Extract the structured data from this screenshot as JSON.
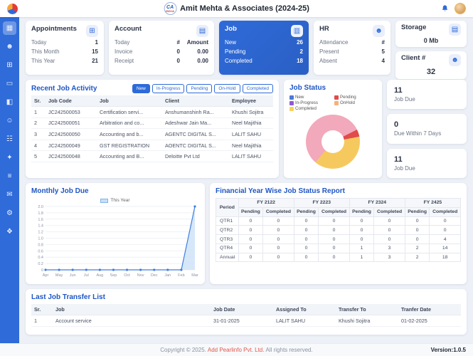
{
  "header": {
    "title": "Amit Mehta & Associates (2024-25)",
    "ca_logo": {
      "top": "CA",
      "bottom": "INDIA"
    }
  },
  "sidebar": {
    "items": [
      {
        "name": "dashboard",
        "glyph": "▦",
        "active": true
      },
      {
        "name": "clients",
        "glyph": "☻",
        "active": false
      },
      {
        "name": "appointments",
        "glyph": "⊞",
        "active": false
      },
      {
        "name": "workstation",
        "glyph": "▭",
        "active": false
      },
      {
        "name": "reports",
        "glyph": "◧",
        "active": false
      },
      {
        "name": "employees",
        "glyph": "☺",
        "active": false
      },
      {
        "name": "attendance",
        "glyph": "☷",
        "active": false
      },
      {
        "name": "jobs",
        "glyph": "✦",
        "active": false
      },
      {
        "name": "job-list",
        "glyph": "≡",
        "active": false
      },
      {
        "name": "documents",
        "glyph": "✉",
        "active": false
      },
      {
        "name": "settings",
        "glyph": "⚙",
        "active": false
      },
      {
        "name": "team",
        "glyph": "❖",
        "active": false
      }
    ]
  },
  "cards": {
    "appointments": {
      "title": "Appointments",
      "icon_glyph": "⊞",
      "rows": [
        [
          "Today",
          "1"
        ],
        [
          "This Month",
          "15"
        ],
        [
          "This Year",
          "21"
        ]
      ]
    },
    "account": {
      "title": "Account",
      "icon_glyph": "▤",
      "header_row": [
        "Today",
        "#",
        "Amount"
      ],
      "rows": [
        [
          "Invoice",
          "0",
          "0.00"
        ],
        [
          "Receipt",
          "0",
          "0.00"
        ]
      ]
    },
    "job": {
      "title": "Job",
      "icon_glyph": "▥",
      "rows": [
        [
          "New",
          "26"
        ],
        [
          "Pending",
          "2"
        ],
        [
          "Completed",
          "18"
        ]
      ]
    },
    "hr": {
      "title": "HR",
      "icon_glyph": "☻",
      "rows": [
        [
          "Attendance",
          "#"
        ],
        [
          "Present",
          "5"
        ],
        [
          "Absent",
          "4"
        ]
      ]
    },
    "storage": {
      "title": "Storage",
      "icon_glyph": "▤",
      "value": "0 Mb"
    },
    "client": {
      "title": "Client #",
      "icon_glyph": "☻",
      "value": "32"
    }
  },
  "recent": {
    "title": "Recent Job Activity",
    "filters": [
      "New",
      "In-Progress",
      "Pending",
      "On-Hold",
      "Completed"
    ],
    "active_filter": "New",
    "columns": [
      "Sr.",
      "Job Code",
      "Job",
      "Client",
      "Employee"
    ],
    "rows": [
      [
        "1",
        "JC242500053",
        "Certification servi...",
        "Anshumanshinh Ra...",
        "Khushi Sojitra"
      ],
      [
        "2",
        "JC242500051",
        "Arbitration and co...",
        "Adeshwar Jain Ma...",
        "Neel Majithia"
      ],
      [
        "3",
        "JC242500050",
        "Accounting and b...",
        "AGENTC DIGITAL S...",
        "LALIT SAHU"
      ],
      [
        "4",
        "JC242500049",
        "GST REGISTRATION",
        "AOENTC DIGITAL S...",
        "Neel Majithia"
      ],
      [
        "5",
        "JC242500048",
        "Accounting and B...",
        "Deloitte Pvt Ltd",
        "LALIT SAHU"
      ]
    ]
  },
  "side_stats": [
    {
      "value": "11",
      "label": "Job Due"
    },
    {
      "value": "0",
      "label": "Due Within 7 Days"
    },
    {
      "value": "11",
      "label": "Job Due"
    }
  ],
  "transfer": {
    "title": "Last Job Transfer List",
    "columns": [
      "Sr.",
      "Job",
      "Job Date",
      "Assigned To",
      "Transfer To",
      "Tranfer Date"
    ],
    "rows": [
      [
        "1",
        "Account service",
        "31-01-2025",
        "LALIT SAHU",
        "Khushi Sojitra",
        "01-02-2025"
      ]
    ]
  },
  "footer": {
    "prefix": "Copyright © 2025.",
    "link": "Add Pearlinfo Pvt. Ltd.",
    "suffix": " All rights reserved.",
    "version": "Version:1.0.5"
  },
  "chart_data": [
    {
      "id": "job_status_donut",
      "type": "pie",
      "title": "Job Status",
      "labels": [
        "New",
        "Pending",
        "In-Progress",
        "OnHold",
        "Completed"
      ],
      "values": [
        26,
        2,
        0,
        0,
        18
      ],
      "legend_colors": [
        "#4e79d6",
        "#e14b4b",
        "#8e5bd4",
        "#f3b27c",
        "#f6d35e"
      ],
      "slice_colors": [
        "#f2a9bb",
        "#e14b4b",
        "#8e5bd4",
        "#f3b27c",
        "#f6c95f"
      ],
      "legend_position": "top"
    },
    {
      "id": "monthly_job_due",
      "type": "line",
      "title": "Monthly Job Due",
      "x": [
        "Apr",
        "May",
        "Jun",
        "Jul",
        "Aug",
        "Sep",
        "Oct",
        "Nov",
        "Dec",
        "Jan",
        "Feb",
        "Mar"
      ],
      "series": [
        {
          "name": "This Year",
          "values": [
            0,
            0,
            0,
            0,
            0,
            0,
            0,
            0,
            0,
            0,
            0,
            2
          ]
        }
      ],
      "ylim": [
        0,
        2
      ],
      "ytick_step": 0.2,
      "grid": true,
      "line_color": "#3f7fe0",
      "fill_color": "#cfe3f8",
      "legend_position": "top"
    },
    {
      "id": "fy_job_status",
      "type": "table",
      "title": "Financial Year Wise Job Status Report",
      "period_header": "Period",
      "year_groups": [
        "FY 2122",
        "FY 2223",
        "FY 2324",
        "FY 2425"
      ],
      "sub_columns": [
        "Pending",
        "Completed"
      ],
      "rows": [
        {
          "period": "QTR1",
          "values": [
            0,
            0,
            0,
            0,
            0,
            0,
            0,
            0
          ]
        },
        {
          "period": "QTR2",
          "values": [
            0,
            0,
            0,
            0,
            0,
            0,
            0,
            0
          ]
        },
        {
          "period": "QTR3",
          "values": [
            0,
            0,
            0,
            0,
            0,
            0,
            0,
            4
          ]
        },
        {
          "period": "QTR4",
          "values": [
            0,
            0,
            0,
            0,
            1,
            3,
            2,
            14
          ]
        },
        {
          "period": "Annual",
          "values": [
            0,
            0,
            0,
            0,
            1,
            3,
            2,
            18
          ]
        }
      ]
    }
  ]
}
